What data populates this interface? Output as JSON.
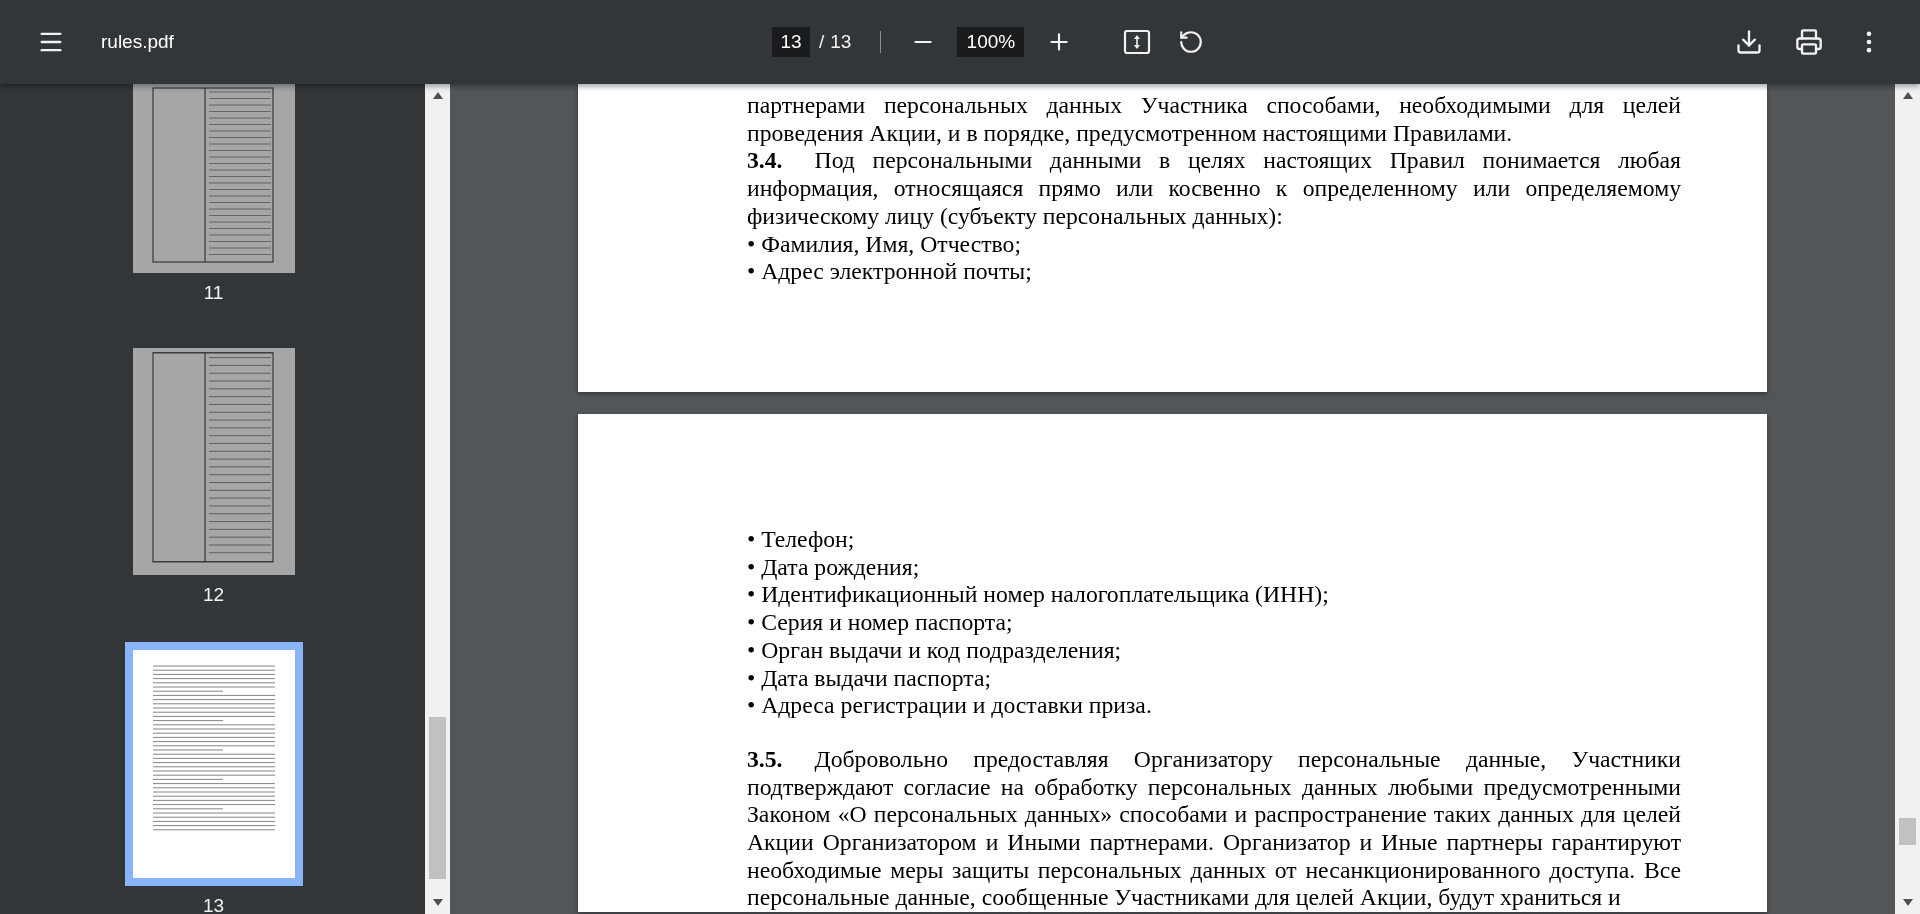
{
  "toolbar": {
    "title": "rules.pdf",
    "page_current": "13",
    "page_separator": "/",
    "page_total": "13",
    "zoom": "100%"
  },
  "thumbnails": [
    {
      "label": "11",
      "selected": false,
      "kind": "table"
    },
    {
      "label": "12",
      "selected": false,
      "kind": "table"
    },
    {
      "label": "13",
      "selected": true,
      "kind": "text"
    }
  ],
  "pages": [
    {
      "blocks": [
        {
          "kind": "paragraph",
          "text": "партнерами персональных данных Участника способами, необходимыми для целей проведения Акции, и в порядке, предусмотренном настоящими Правилами."
        },
        {
          "kind": "paragraph",
          "number": "3.4.",
          "text": "Под персональными данными в целях настоящих Правил понимается любая информация, относящаяся прямо или косвенно к определенному или определяемому физическому лицу (субъекту персональных данных):"
        },
        {
          "kind": "bullet",
          "text": "• Фамилия, Имя, Отчество;"
        },
        {
          "kind": "bullet",
          "text": "• Адрес электронной почты;"
        }
      ]
    },
    {
      "blocks": [
        {
          "kind": "bullet",
          "text": "• Телефон;"
        },
        {
          "kind": "bullet",
          "text": "• Дата рождения;"
        },
        {
          "kind": "bullet",
          "text": "• Идентификационный номер налогоплательщика (ИНН);"
        },
        {
          "kind": "bullet",
          "text": "• Серия и номер паспорта;"
        },
        {
          "kind": "bullet",
          "text": "• Орган выдачи и код подразделения;"
        },
        {
          "kind": "bullet",
          "text": "• Дата выдачи паспорта;"
        },
        {
          "kind": "bullet",
          "text": "• Адреса регистрации и доставки приза."
        },
        {
          "kind": "paragraph",
          "number": "3.5.",
          "text": "Добровольно предоставляя Организатору персональные данные, Участники подтверждают согласие на обработку персональных данных любыми предусмотренными Законом «О персональных данных» способами и распространение таких данных для целей Акции Организатором и Иными партнерами. Организатор и Иные партнеры гарантируют необходимые меры защиты персональных данных от несанкционированного доступа. Все персональные данные, сообщенные Участниками для целей Акции, будут храниться и"
        }
      ]
    }
  ]
}
